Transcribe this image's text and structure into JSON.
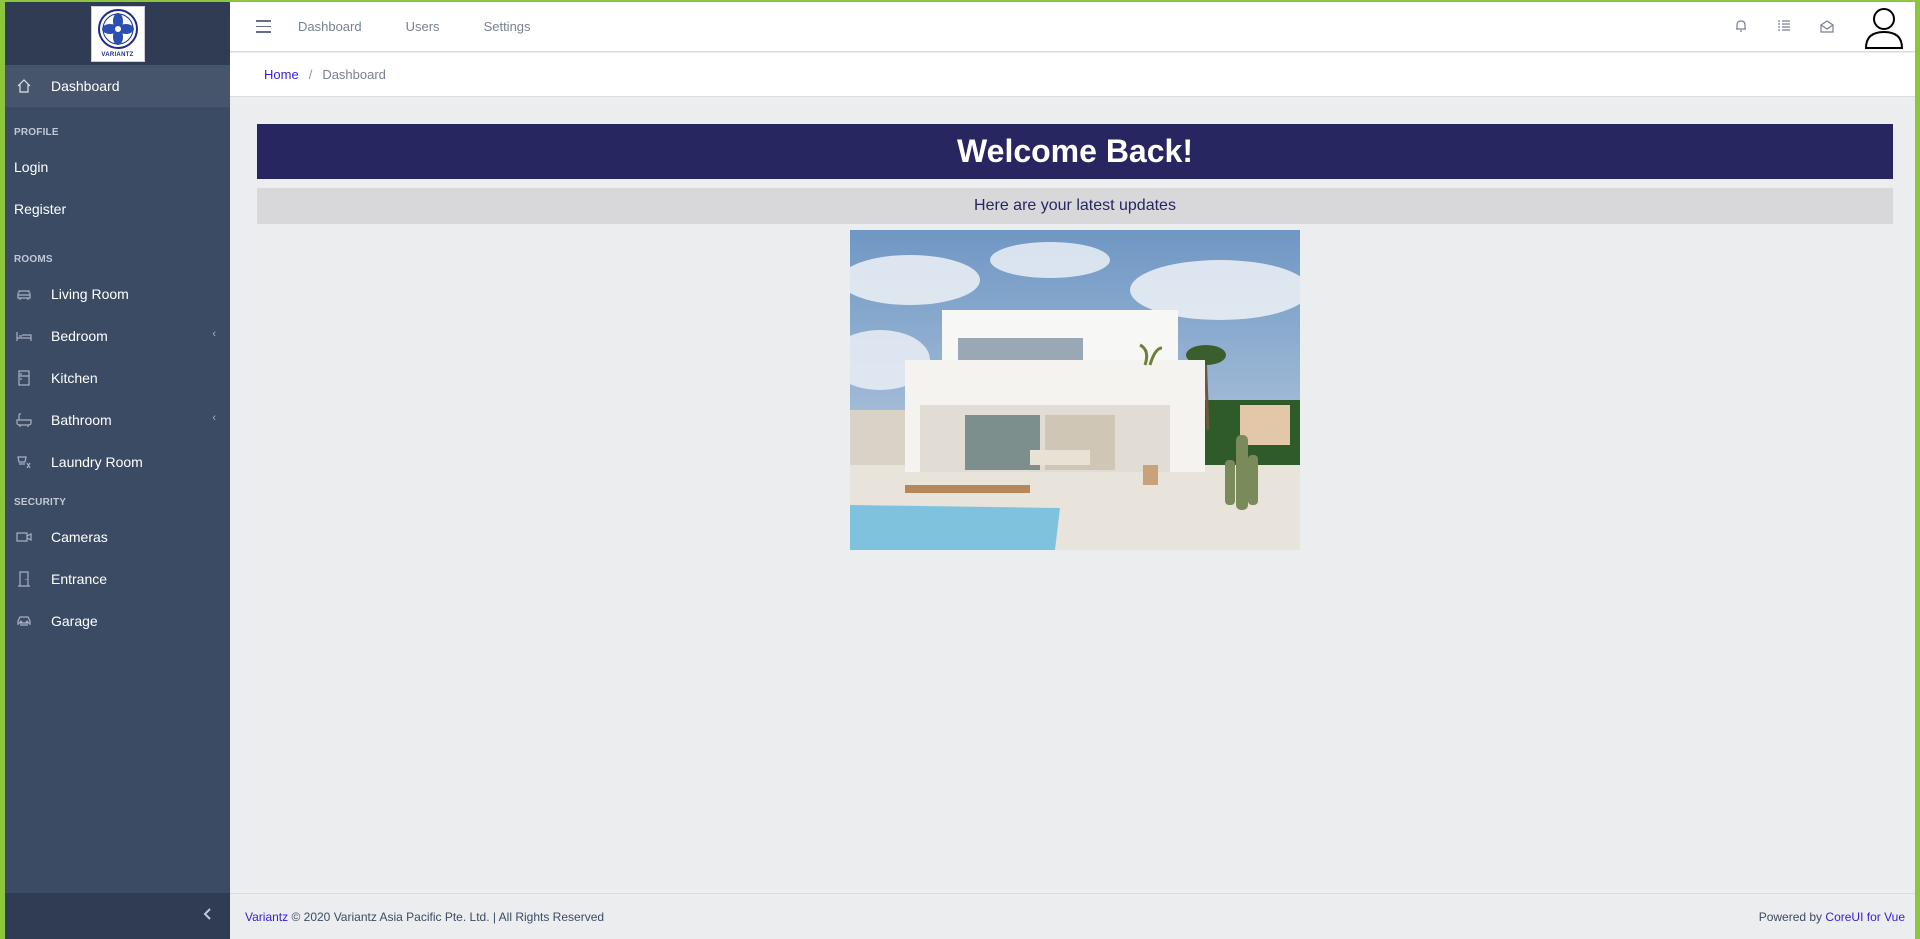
{
  "brand": {
    "logo_text": "VARIANTZ"
  },
  "sidebar": {
    "active_item": {
      "label": "Dashboard",
      "icon": "home-icon"
    },
    "sections": [
      {
        "title": "PROFILE",
        "items": [
          {
            "label": "Login"
          },
          {
            "label": "Register"
          }
        ]
      },
      {
        "title": "ROOMS",
        "items": [
          {
            "label": "Living Room",
            "icon": "sofa-icon"
          },
          {
            "label": "Bedroom",
            "icon": "bed-icon",
            "has_children": true
          },
          {
            "label": "Kitchen",
            "icon": "fridge-icon"
          },
          {
            "label": "Bathroom",
            "icon": "bathtub-icon",
            "has_children": true
          },
          {
            "label": "Laundry Room",
            "icon": "washing-icon"
          }
        ]
      },
      {
        "title": "SECURITY",
        "items": [
          {
            "label": "Cameras",
            "icon": "camera-icon"
          },
          {
            "label": "Entrance",
            "icon": "door-icon"
          },
          {
            "label": "Garage",
            "icon": "car-icon"
          }
        ]
      }
    ],
    "toggler_icon": "chevron-left-icon"
  },
  "header": {
    "nav": [
      {
        "label": "Dashboard"
      },
      {
        "label": "Users"
      },
      {
        "label": "Settings"
      }
    ],
    "icons": [
      "bell-icon",
      "list-icon",
      "envelope-open-icon",
      "user-avatar-icon"
    ]
  },
  "breadcrumb": {
    "home": "Home",
    "separator": "/",
    "current": "Dashboard"
  },
  "main": {
    "welcome_title": "Welcome Back!",
    "subtitle": "Here are your latest updates",
    "image": "modern-white-house-with-pool"
  },
  "footer": {
    "brand_link": "Variantz",
    "copyright": "© 2020 Variantz Asia Pacific Pte. Ltd. | All Rights Reserved",
    "powered_by": "Powered by",
    "powered_link": "CoreUI for Vue"
  },
  "colors": {
    "sidebar_bg": "#3c4b64",
    "banner_bg": "#272661",
    "link": "#321fdb",
    "outer_border": "#8cc63f"
  }
}
